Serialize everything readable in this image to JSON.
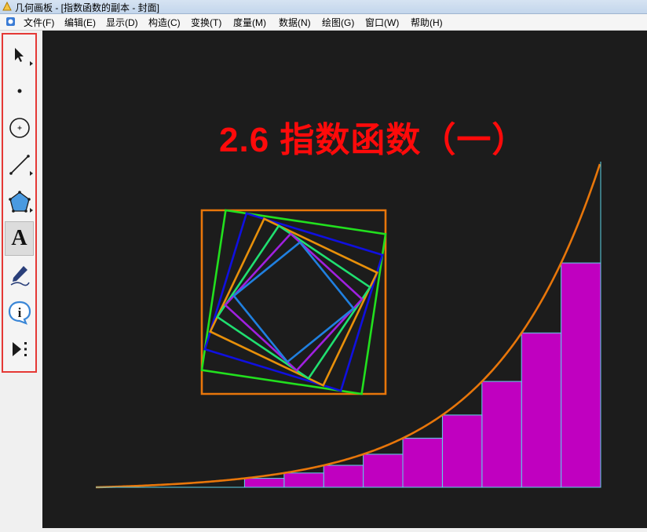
{
  "window": {
    "title": "几何画板 - [指数函数的副本 - 封面]"
  },
  "menu": {
    "items": [
      "文件(F)",
      "编辑(E)",
      "显示(D)",
      "构造(C)",
      "变换(T)",
      "度量(M)",
      "数据(N)",
      "绘图(G)",
      "窗口(W)",
      "帮助(H)"
    ]
  },
  "toolbox": {
    "highlight_color": "#e53935",
    "tools": [
      {
        "name": "arrow-select-tool",
        "icon": "arrow-cursor-icon"
      },
      {
        "name": "point-tool",
        "icon": "point-icon"
      },
      {
        "name": "compass-tool",
        "icon": "circle-icon"
      },
      {
        "name": "straightedge-tool",
        "icon": "segment-icon"
      },
      {
        "name": "polygon-tool",
        "icon": "pentagon-icon"
      },
      {
        "name": "text-tool",
        "icon": "text-a-icon",
        "label": "A"
      },
      {
        "name": "marker-tool",
        "icon": "pen-icon"
      },
      {
        "name": "information-tool",
        "icon": "info-icon",
        "label": "i"
      },
      {
        "name": "custom-tool",
        "icon": "play-dots-icon"
      }
    ]
  },
  "canvas": {
    "background": "#1c1c1c",
    "title": "2.6 指数函数（一）",
    "title_color": "#ff0a0a",
    "curve_color": "#e8760a",
    "bar_color": "#c000c0",
    "bar_outline_color": "#5ed4e8",
    "square_colors": [
      "#e8760a",
      "#22e01e",
      "#1010e0",
      "#e8900a",
      "#20e070",
      "#a020e0",
      "#2080e0"
    ]
  }
}
